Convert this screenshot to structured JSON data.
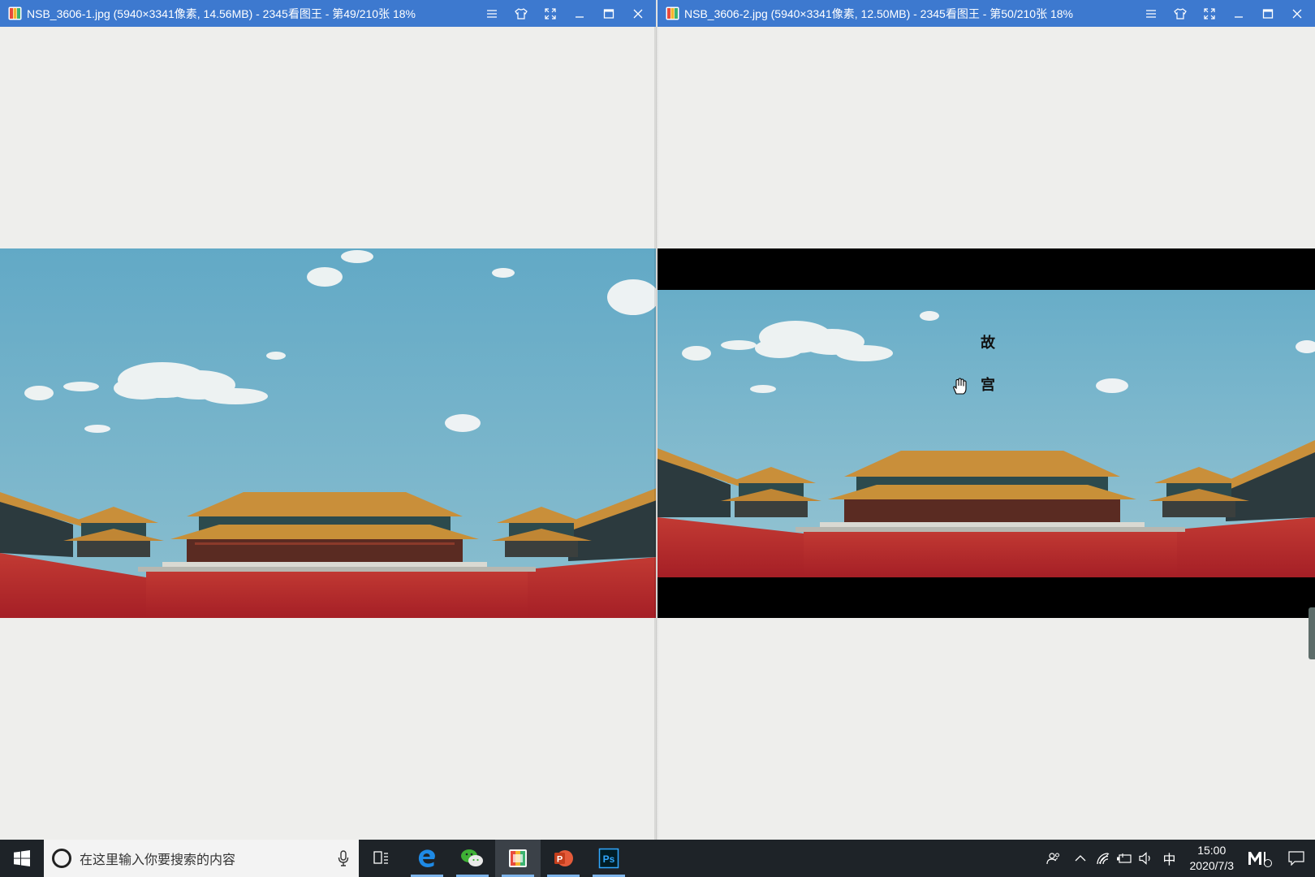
{
  "left_window": {
    "title": "NSB_3606-1.jpg  (5940×3341像素, 14.56MB)  - 2345看图王 - 第49/210张 18%"
  },
  "right_window": {
    "title": "NSB_3606-2.jpg  (5940×3341像素, 12.50MB)  - 2345看图王 - 第50/210张 18%",
    "overlay_text": [
      "故",
      "宫"
    ]
  },
  "taskbar": {
    "search_placeholder": "在这里输入你要搜索的内容",
    "pinned_apps": [
      "task-view",
      "edge",
      "wechat",
      "2345-viewer",
      "powerpoint",
      "photoshop"
    ],
    "ime_indicator": "中",
    "clock_time": "15:00",
    "clock_date": "2020/7/3"
  },
  "colors": {
    "titlebar": "#3d79cf",
    "taskbar": "#1e2328",
    "sky": "#6aaec8",
    "palace_wall": "#b3262b",
    "roof": "#c98f3a"
  }
}
